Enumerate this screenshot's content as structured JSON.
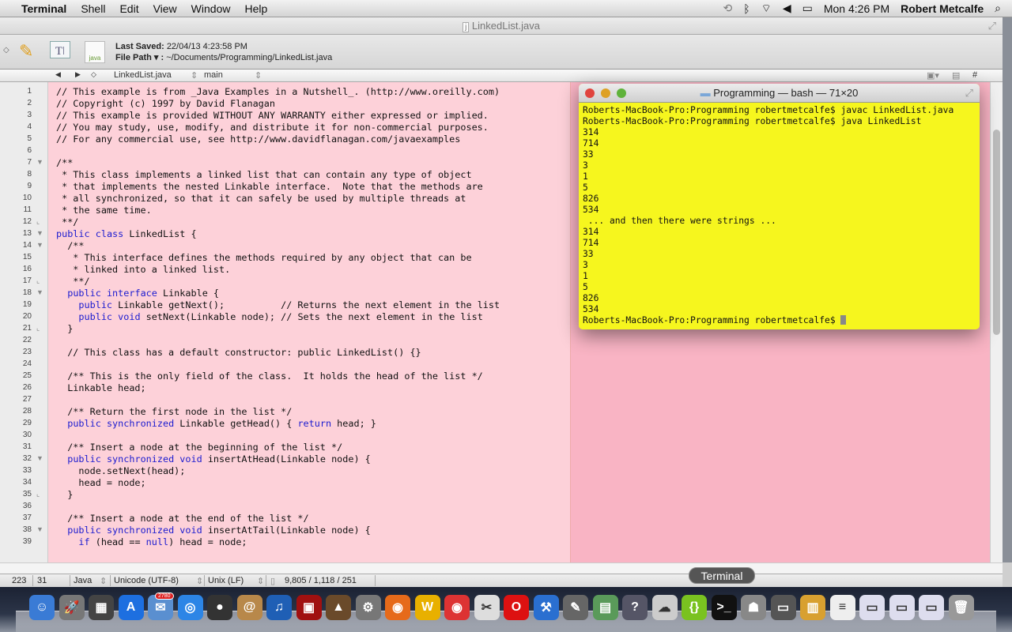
{
  "menubar": {
    "apple": "",
    "app": "Terminal",
    "items": [
      "Shell",
      "Edit",
      "View",
      "Window",
      "Help"
    ],
    "clock": "Mon 4:26 PM",
    "user": "Robert Metcalfe",
    "status_icons": [
      "time-machine-icon",
      "bluetooth-icon",
      "wifi-icon",
      "volume-icon",
      "battery-icon",
      "spotlight-icon"
    ]
  },
  "editor_window": {
    "title": "LinkedList.java",
    "last_saved_label": "Last Saved:",
    "last_saved": "22/04/13 4:23:58 PM",
    "file_path_label": "File Path ▾ :",
    "file_path": "~/Documents/Programming/LinkedList.java",
    "nav": {
      "file": "LinkedList.java",
      "symbol": "main",
      "hash": "#"
    },
    "keywords": [
      "public",
      "class",
      "interface",
      "void",
      "synchronized",
      "return",
      "null",
      "if"
    ],
    "lines": [
      "// This example is from _Java Examples in a Nutshell_. (http://www.oreilly.com)",
      "// Copyright (c) 1997 by David Flanagan",
      "// This example is provided WITHOUT ANY WARRANTY either expressed or implied.",
      "// You may study, use, modify, and distribute it for non-commercial purposes.",
      "// For any commercial use, see http://www.davidflanagan.com/javaexamples",
      "",
      "/**",
      " * This class implements a linked list that can contain any type of object",
      " * that implements the nested Linkable interface.  Note that the methods are",
      " * all synchronized, so that it can safely be used by multiple threads at",
      " * the same time.",
      " **/",
      "public class LinkedList {",
      "  /**",
      "   * This interface defines the methods required by any object that can be",
      "   * linked into a linked list.",
      "   **/",
      "  public interface Linkable {",
      "    public Linkable getNext();          // Returns the next element in the list",
      "    public void setNext(Linkable node); // Sets the next element in the list",
      "  }",
      "",
      "  // This class has a default constructor: public LinkedList() {}",
      "",
      "  /** This is the only field of the class.  It holds the head of the list */",
      "  Linkable head;",
      "",
      "  /** Return the first node in the list */",
      "  public synchronized Linkable getHead() { return head; }",
      "",
      "  /** Insert a node at the beginning of the list */",
      "  public synchronized void insertAtHead(Linkable node) {",
      "    node.setNext(head);",
      "    head = node;",
      "  }",
      "",
      "  /** Insert a node at the end of the list */",
      "  public synchronized void insertAtTail(Linkable node) {",
      "    if (head == null) head = node;"
    ],
    "fold_open": [
      7,
      13,
      14,
      18,
      32,
      38
    ],
    "fold_close": [
      12,
      17,
      21,
      35
    ],
    "status": {
      "line": "223",
      "col": "31",
      "language": "Java",
      "encoding": "Unicode (UTF-8)",
      "line_endings": "Unix (LF)",
      "counts": "9,805 / 1,118 / 251"
    },
    "colors": {
      "editor_bg": "#fdd1d9",
      "keyword": "#1b1bd0"
    }
  },
  "terminal": {
    "title": "Programming — bash — 71×20",
    "lines": [
      "Roberts-MacBook-Pro:Programming robertmetcalfe$ javac LinkedList.java",
      "Roberts-MacBook-Pro:Programming robertmetcalfe$ java LinkedList",
      "314",
      "714",
      "33",
      "3",
      "1",
      "5",
      "826",
      "534",
      " ... and then there were strings ...",
      "314",
      "714",
      "33",
      "3",
      "1",
      "5",
      "826",
      "534"
    ],
    "prompt": "Roberts-MacBook-Pro:Programming robertmetcalfe$ ",
    "bg_color": "#f6f61e"
  },
  "dock": {
    "tooltip": "Terminal",
    "mail_badge": "2780",
    "apps": [
      {
        "name": "finder",
        "color": "#3a7bd5",
        "glyph": "☺"
      },
      {
        "name": "launchpad",
        "color": "#777",
        "glyph": "🚀"
      },
      {
        "name": "mission-control",
        "color": "#444",
        "glyph": "▦"
      },
      {
        "name": "app-store",
        "color": "#1d6fe0",
        "glyph": "A"
      },
      {
        "name": "mail",
        "color": "#5a8fd0",
        "glyph": "✉"
      },
      {
        "name": "safari",
        "color": "#2c85e6",
        "glyph": "◎"
      },
      {
        "name": "facetime",
        "color": "#333",
        "glyph": "●"
      },
      {
        "name": "address-book",
        "color": "#b8884a",
        "glyph": "@"
      },
      {
        "name": "itunes",
        "color": "#1f5fb5",
        "glyph": "♫"
      },
      {
        "name": "photo-booth",
        "color": "#a01010",
        "glyph": "▣"
      },
      {
        "name": "iphoto",
        "color": "#6a4a2a",
        "glyph": "▲"
      },
      {
        "name": "system-preferences",
        "color": "#777",
        "glyph": "⚙"
      },
      {
        "name": "firefox",
        "color": "#e66a1a",
        "glyph": "◉"
      },
      {
        "name": "wunderlist",
        "color": "#e8b000",
        "glyph": "W"
      },
      {
        "name": "chrome",
        "color": "#d33",
        "glyph": "◉"
      },
      {
        "name": "script-editor",
        "color": "#ddd",
        "glyph": "✂"
      },
      {
        "name": "opera",
        "color": "#d11",
        "glyph": "O"
      },
      {
        "name": "xcode",
        "color": "#2a6fd0",
        "glyph": "⚒"
      },
      {
        "name": "gimp",
        "color": "#666",
        "glyph": "✎"
      },
      {
        "name": "preview",
        "color": "#5a9a5a",
        "glyph": "▤"
      },
      {
        "name": "help",
        "color": "#556",
        "glyph": "?"
      },
      {
        "name": "cyberduck",
        "color": "#ccc",
        "glyph": "☁"
      },
      {
        "name": "brackets",
        "color": "#7ac220",
        "glyph": "{}"
      },
      {
        "name": "terminal",
        "color": "#111",
        "glyph": ">_"
      },
      {
        "name": "automator",
        "color": "#888",
        "glyph": "☗"
      },
      {
        "name": "generic-app",
        "color": "#555",
        "glyph": "▭"
      },
      {
        "name": "archive-utility",
        "color": "#d8a030",
        "glyph": "▥"
      },
      {
        "name": "text-document",
        "color": "#eee",
        "glyph": "≡"
      },
      {
        "name": "screenshot-1",
        "color": "#dde",
        "glyph": "▭"
      },
      {
        "name": "screenshot-2",
        "color": "#dde",
        "glyph": "▭"
      },
      {
        "name": "screenshot-3",
        "color": "#dde",
        "glyph": "▭"
      },
      {
        "name": "trash",
        "color": "#999",
        "glyph": "🗑"
      }
    ]
  }
}
